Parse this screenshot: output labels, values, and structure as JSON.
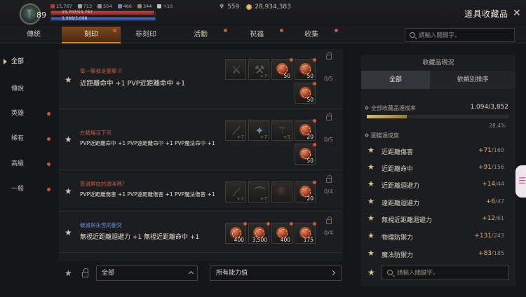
{
  "player": {
    "level": "89",
    "stats": [
      "15,767",
      "713",
      "554",
      "466",
      "344",
      "+10"
    ],
    "hp_text": "15,707/15,767",
    "hp_fraction": 0.99,
    "mp_text": "3,098/3,098",
    "mp_fraction": 1.0
  },
  "currency": {
    "wings": "559",
    "gold": "28,934,383"
  },
  "window": {
    "title": "道具收藏品",
    "close": "✕"
  },
  "tabs": [
    {
      "label": "傳統",
      "active": false,
      "dot": false
    },
    {
      "label": "刻印",
      "active": true,
      "dot": true
    },
    {
      "label": "非刻印",
      "active": false,
      "dot": false
    },
    {
      "label": "活動",
      "active": false,
      "dot": true
    },
    {
      "label": "祝福",
      "active": false,
      "dot": true
    },
    {
      "label": "收集",
      "active": false,
      "dot": true
    }
  ],
  "search": {
    "placeholder": "請輸入關鍵字。"
  },
  "categories": [
    {
      "label": "全部",
      "active": true,
      "dot": false
    },
    {
      "label": "傳說",
      "active": false,
      "dot": false
    },
    {
      "label": "英雄",
      "active": false,
      "dot": true
    },
    {
      "label": "稀有",
      "active": false,
      "dot": true
    },
    {
      "label": "高級",
      "active": false,
      "dot": true
    },
    {
      "label": "一般",
      "active": false,
      "dot": true
    }
  ],
  "collections": [
    {
      "name": "每一擊都是暴擊 II",
      "name_color": "red",
      "effects": "近距離命中 +1 PVP近距離命中 +1",
      "progress": "0/5",
      "starred": true,
      "items": [
        {
          "kind": "weapon",
          "glyph": "⚔",
          "label": ""
        },
        {
          "kind": "weapon",
          "glyph": "⚒",
          "label": "+7"
        },
        {
          "kind": "gem",
          "label": "50"
        },
        {
          "kind": "gem",
          "label": "50"
        },
        {
          "kind": "gem",
          "label": "50"
        }
      ]
    },
    {
      "name": "在戰場活下來",
      "name_color": "red",
      "effects": "PVP近距離命中 +1 PVP遠距離命中 +1 PVP魔法命中 +1",
      "progress": "0/5",
      "starred": false,
      "items": [
        {
          "kind": "weapon",
          "glyph": "⟋",
          "label": "+7"
        },
        {
          "kind": "weapon",
          "glyph": "✦",
          "label": "+7",
          "bright": true
        },
        {
          "kind": "weapon",
          "glyph": "⚚",
          "label": "+5"
        },
        {
          "kind": "gem",
          "label": "20"
        },
        {
          "kind": "gem",
          "label": "50"
        }
      ]
    },
    {
      "name": "嘗過鮮血的滋味嗎？",
      "name_color": "red",
      "effects": "PVP近距離傷害 +1 PVP遠距離傷害 +1 PVP魔法傷害 +1",
      "progress": "0/4",
      "starred": false,
      "items": [
        {
          "kind": "weapon",
          "glyph": "⟋",
          "label": "+7"
        },
        {
          "kind": "weapon",
          "glyph": "⌒",
          "label": "+7"
        },
        {
          "kind": "dimgem",
          "label": ""
        },
        {
          "kind": "gem",
          "label": "20"
        }
      ]
    },
    {
      "name": "破滅與永恆的衝突",
      "name_color": "blue",
      "effects": "無視近距離迴避力 +1 無視近距離命中 +1",
      "progress": "0/4",
      "starred": false,
      "items": [
        {
          "kind": "gem",
          "label": "400"
        },
        {
          "kind": "gem",
          "label": "3,500"
        },
        {
          "kind": "gem",
          "label": "400"
        },
        {
          "kind": "gem",
          "label": "175"
        }
      ]
    }
  ],
  "bottom": {
    "filter_grade": "全部",
    "filter_stat": "所有能力值"
  },
  "summary": {
    "title": "收藏品現況",
    "tab_all": "全部",
    "tab_sort": "依類別排序",
    "overall_label": "全部收藏品達成率",
    "overall_value": "1,094/3,852",
    "overall_percent": "28.4%",
    "overall_fraction": 0.284,
    "icon_label": "圖鑑達成度",
    "stats": [
      {
        "name": "近距離傷害",
        "value": "+71",
        "max": "/160"
      },
      {
        "name": "近距離命中",
        "value": "+91",
        "max": "/156"
      },
      {
        "name": "近距離迴避力",
        "value": "+14",
        "max": "/44"
      },
      {
        "name": "遠距離迴避力",
        "value": "+6",
        "max": "/47"
      },
      {
        "name": "無視近距離迴避力",
        "value": "+12",
        "max": "/61"
      },
      {
        "name": "物理防禦力",
        "value": "+131",
        "max": "/243"
      },
      {
        "name": "魔法防禦力",
        "value": "+83",
        "max": "/185"
      }
    ],
    "search_placeholder": "請輸入關鍵字。"
  },
  "colors": {
    "accent": "#d48a3a",
    "gold": "#d9b067",
    "name_red": "#c05a3c",
    "name_blue": "#6c8fd0"
  }
}
